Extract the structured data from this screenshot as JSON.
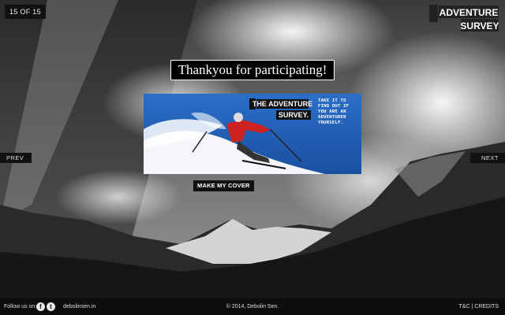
{
  "slide_counter": "15 OF 15",
  "logo": {
    "line1": "THE ADVENTURE",
    "line2": "SURVEY"
  },
  "main": {
    "title": "Thankyou for participating!",
    "cover": {
      "brand_line1": "THE ADVENTURE",
      "brand_line2": "SURVEY.",
      "tagline": "TAKE IT TO FIND OUT IF YOU ARE AN ADVENTURER YOURSELF."
    },
    "make_cover_label": "MAKE MY COVER"
  },
  "nav": {
    "prev_label": "PREV",
    "next_label": "NEXT"
  },
  "footer": {
    "follow_label": "Follow us on:",
    "facebook_glyph": "f",
    "twitter_glyph": "t",
    "site_link": "debolinsen.in",
    "copyright": "© 2014, Debolin Sen.",
    "tc_label": "T&C",
    "separator": "|",
    "credits_label": "CREDITS"
  },
  "colors": {
    "cover_sky": "#1f5fb8",
    "skier_jacket": "#cc2222",
    "footer_bg": "#0d0d0d"
  }
}
